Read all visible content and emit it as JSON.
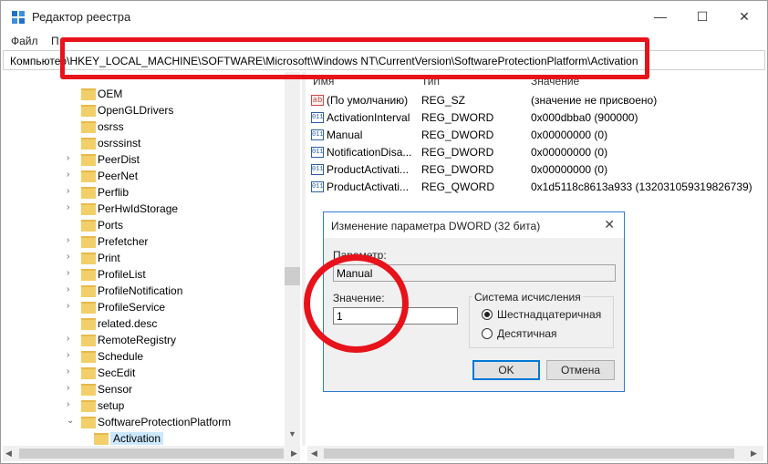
{
  "window": {
    "title": "Редактор реестра",
    "minimize_glyph": "—",
    "maximize_glyph": "☐",
    "close_glyph": "✕"
  },
  "menu": [
    "Файл",
    "П"
  ],
  "address": "Компьютер\\HKEY_LOCAL_MACHINE\\SOFTWARE\\Microsoft\\Windows NT\\CurrentVersion\\SoftwareProtectionPlatform\\Activation",
  "accent_color": "#e8121b",
  "tree": [
    {
      "label": "OEM",
      "expandable": false
    },
    {
      "label": "OpenGLDrivers",
      "expandable": false
    },
    {
      "label": "osrss",
      "expandable": false
    },
    {
      "label": "osrssinst",
      "expandable": false
    },
    {
      "label": "PeerDist",
      "expandable": true
    },
    {
      "label": "PeerNet",
      "expandable": true
    },
    {
      "label": "Perflib",
      "expandable": true
    },
    {
      "label": "PerHwIdStorage",
      "expandable": true
    },
    {
      "label": "Ports",
      "expandable": false
    },
    {
      "label": "Prefetcher",
      "expandable": true
    },
    {
      "label": "Print",
      "expandable": true
    },
    {
      "label": "ProfileList",
      "expandable": true
    },
    {
      "label": "ProfileNotification",
      "expandable": true
    },
    {
      "label": "ProfileService",
      "expandable": true
    },
    {
      "label": "related.desc",
      "expandable": false
    },
    {
      "label": "RemoteRegistry",
      "expandable": true
    },
    {
      "label": "Schedule",
      "expandable": true
    },
    {
      "label": "SecEdit",
      "expandable": true
    },
    {
      "label": "Sensor",
      "expandable": true
    },
    {
      "label": "setup",
      "expandable": true
    },
    {
      "label": "SoftwareProtectionPlatform",
      "expandable": true,
      "expanded": true
    },
    {
      "label": "Activation",
      "expandable": false,
      "selected": true
    }
  ],
  "list": {
    "headers": [
      "Имя",
      "Тип",
      "Значение"
    ],
    "rows": [
      {
        "icon": "ab",
        "name": "(По умолчанию)",
        "type": "REG_SZ",
        "value": "(значение не присвоено)"
      },
      {
        "icon": "bin",
        "name": "ActivationInterval",
        "type": "REG_DWORD",
        "value": "0x000dbba0 (900000)"
      },
      {
        "icon": "bin",
        "name": "Manual",
        "type": "REG_DWORD",
        "value": "0x00000000 (0)"
      },
      {
        "icon": "bin",
        "name": "NotificationDisa...",
        "type": "REG_DWORD",
        "value": "0x00000000 (0)"
      },
      {
        "icon": "bin",
        "name": "ProductActivati...",
        "type": "REG_DWORD",
        "value": "0x00000000 (0)"
      },
      {
        "icon": "bin",
        "name": "ProductActivati...",
        "type": "REG_QWORD",
        "value": "0x1d5118c8613a933 (132031059319826739)"
      }
    ]
  },
  "dialog": {
    "title": "Изменение параметра DWORD (32 бита)",
    "name_label": "Параметр:",
    "name_value": "Manual",
    "value_label": "Значение:",
    "value_value": "1",
    "base_label": "Система исчисления",
    "radio_hex": "Шестнадцатеричная",
    "radio_dec": "Десятичная",
    "selected_base": "hex",
    "ok": "OK",
    "cancel": "Отмена"
  }
}
